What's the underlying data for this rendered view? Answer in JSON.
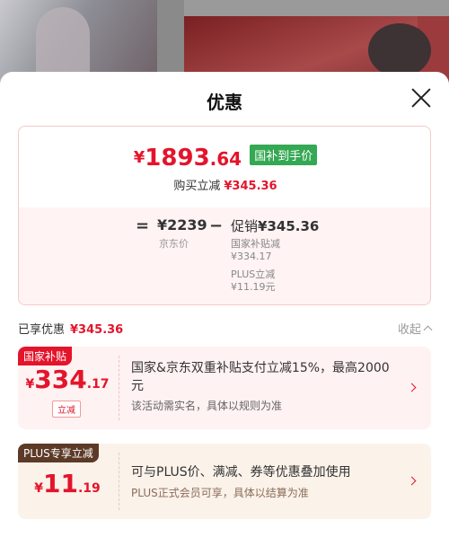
{
  "sheet": {
    "title": "优惠"
  },
  "price_card": {
    "final_price_currency": "¥",
    "final_price_int": "1893",
    "final_price_dec": ".64",
    "gov_badge": "国补到手价",
    "buy_label": "购买立减",
    "buy_amount": "¥345.36",
    "equals": "=",
    "jd_price": "¥2239",
    "jd_label": "京东价",
    "minus": "−",
    "promo_label": "促销",
    "promo_amount": "¥345.36",
    "gov_subsidy_label": "国家补贴减",
    "gov_subsidy_amount": "¥334.17",
    "plus_label": "PLUS立减",
    "plus_amount": "¥11.19元"
  },
  "enjoyed": {
    "label": "已享优惠",
    "amount": "¥345.36",
    "collapse_label": "收起"
  },
  "discounts": [
    {
      "tag": "国家补贴",
      "currency": "¥",
      "amount_int": "334",
      "amount_dec": ".17",
      "type_label": "立减",
      "text": "国家&京东双重补贴支付立减15%，最高2000元",
      "subtext": "该活动需实名，具体以规则为准"
    },
    {
      "tag": "PLUS专享立减",
      "currency": "¥",
      "amount_int": "11",
      "amount_dec": ".19",
      "text": "可与PLUS价、满减、券等优惠叠加使用",
      "subtext": "PLUS正式会员可享，具体以结算为准"
    }
  ]
}
